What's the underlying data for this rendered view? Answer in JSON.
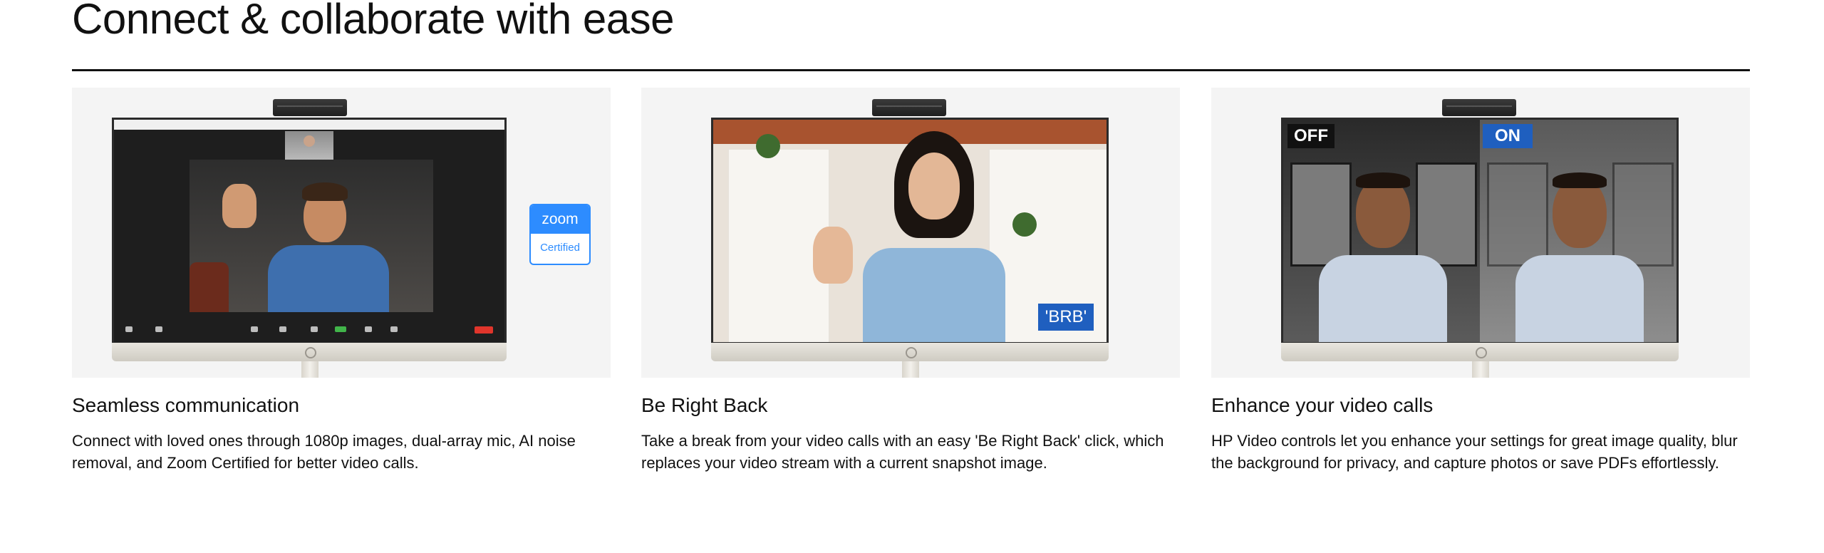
{
  "section": {
    "title": "Connect & collaborate with ease"
  },
  "cards": [
    {
      "heading": "Seamless communication",
      "description": "Connect with loved ones through 1080p images, dual-array mic, AI noise removal, and Zoom Certified for better video calls.",
      "badge": {
        "brand": "zoom",
        "label": "Certified"
      }
    },
    {
      "heading": "Be Right Back",
      "description": "Take a break from your video calls with an easy 'Be Right Back' click, which replaces your video stream with a current snapshot image.",
      "overlay": "'BRB'"
    },
    {
      "heading": "Enhance your video calls",
      "description": "HP Video controls let you enhance your settings for great image quality, blur the background for privacy, and capture photos or save PDFs effortlessly.",
      "labels": {
        "off": "OFF",
        "on": "ON"
      }
    }
  ],
  "colors": {
    "text": "#111111",
    "card_bg": "#f4f4f4",
    "zoom_blue": "#2d8cff",
    "brb_blue": "#1f5fbf"
  }
}
